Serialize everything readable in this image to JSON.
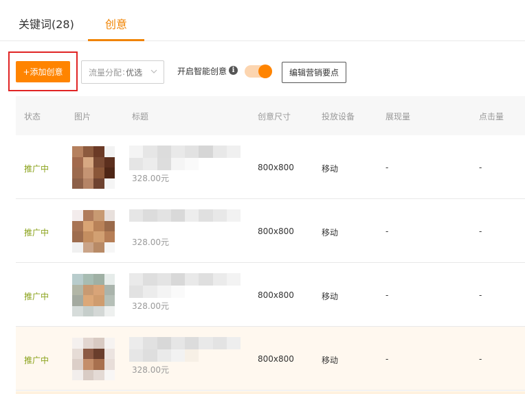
{
  "tabs": [
    {
      "label": "关键词(28)"
    },
    {
      "label": "创意"
    }
  ],
  "toolbar": {
    "add_label": "+添加创意",
    "traffic_label": "流量分配",
    "traffic_sep": ":",
    "traffic_value": "优选",
    "smart_label": "开启智能创意",
    "info_glyph": "i",
    "smart_enabled": true,
    "edit_label": "编辑营销要点"
  },
  "colors": {
    "accent": "#ff8400",
    "status_active": "#8aa21a",
    "highlight_border": "#e02424"
  },
  "table": {
    "headers": [
      "状态",
      "图片",
      "标题",
      "创意尺寸",
      "投放设备",
      "展现量",
      "点击量"
    ],
    "rows": [
      {
        "status": "推广中",
        "price": "328.00元",
        "size": "800x800",
        "device": "移动",
        "impressions": "-",
        "clicks": "-"
      },
      {
        "status": "推广中",
        "price": "328.00元",
        "size": "800x800",
        "device": "移动",
        "impressions": "-",
        "clicks": "-"
      },
      {
        "status": "推广中",
        "price": "328.00元",
        "size": "800x800",
        "device": "移动",
        "impressions": "-",
        "clicks": "-"
      },
      {
        "status": "推广中",
        "price": "328.00元",
        "size": "800x800",
        "device": "移动",
        "impressions": "-",
        "clicks": "-"
      }
    ]
  }
}
